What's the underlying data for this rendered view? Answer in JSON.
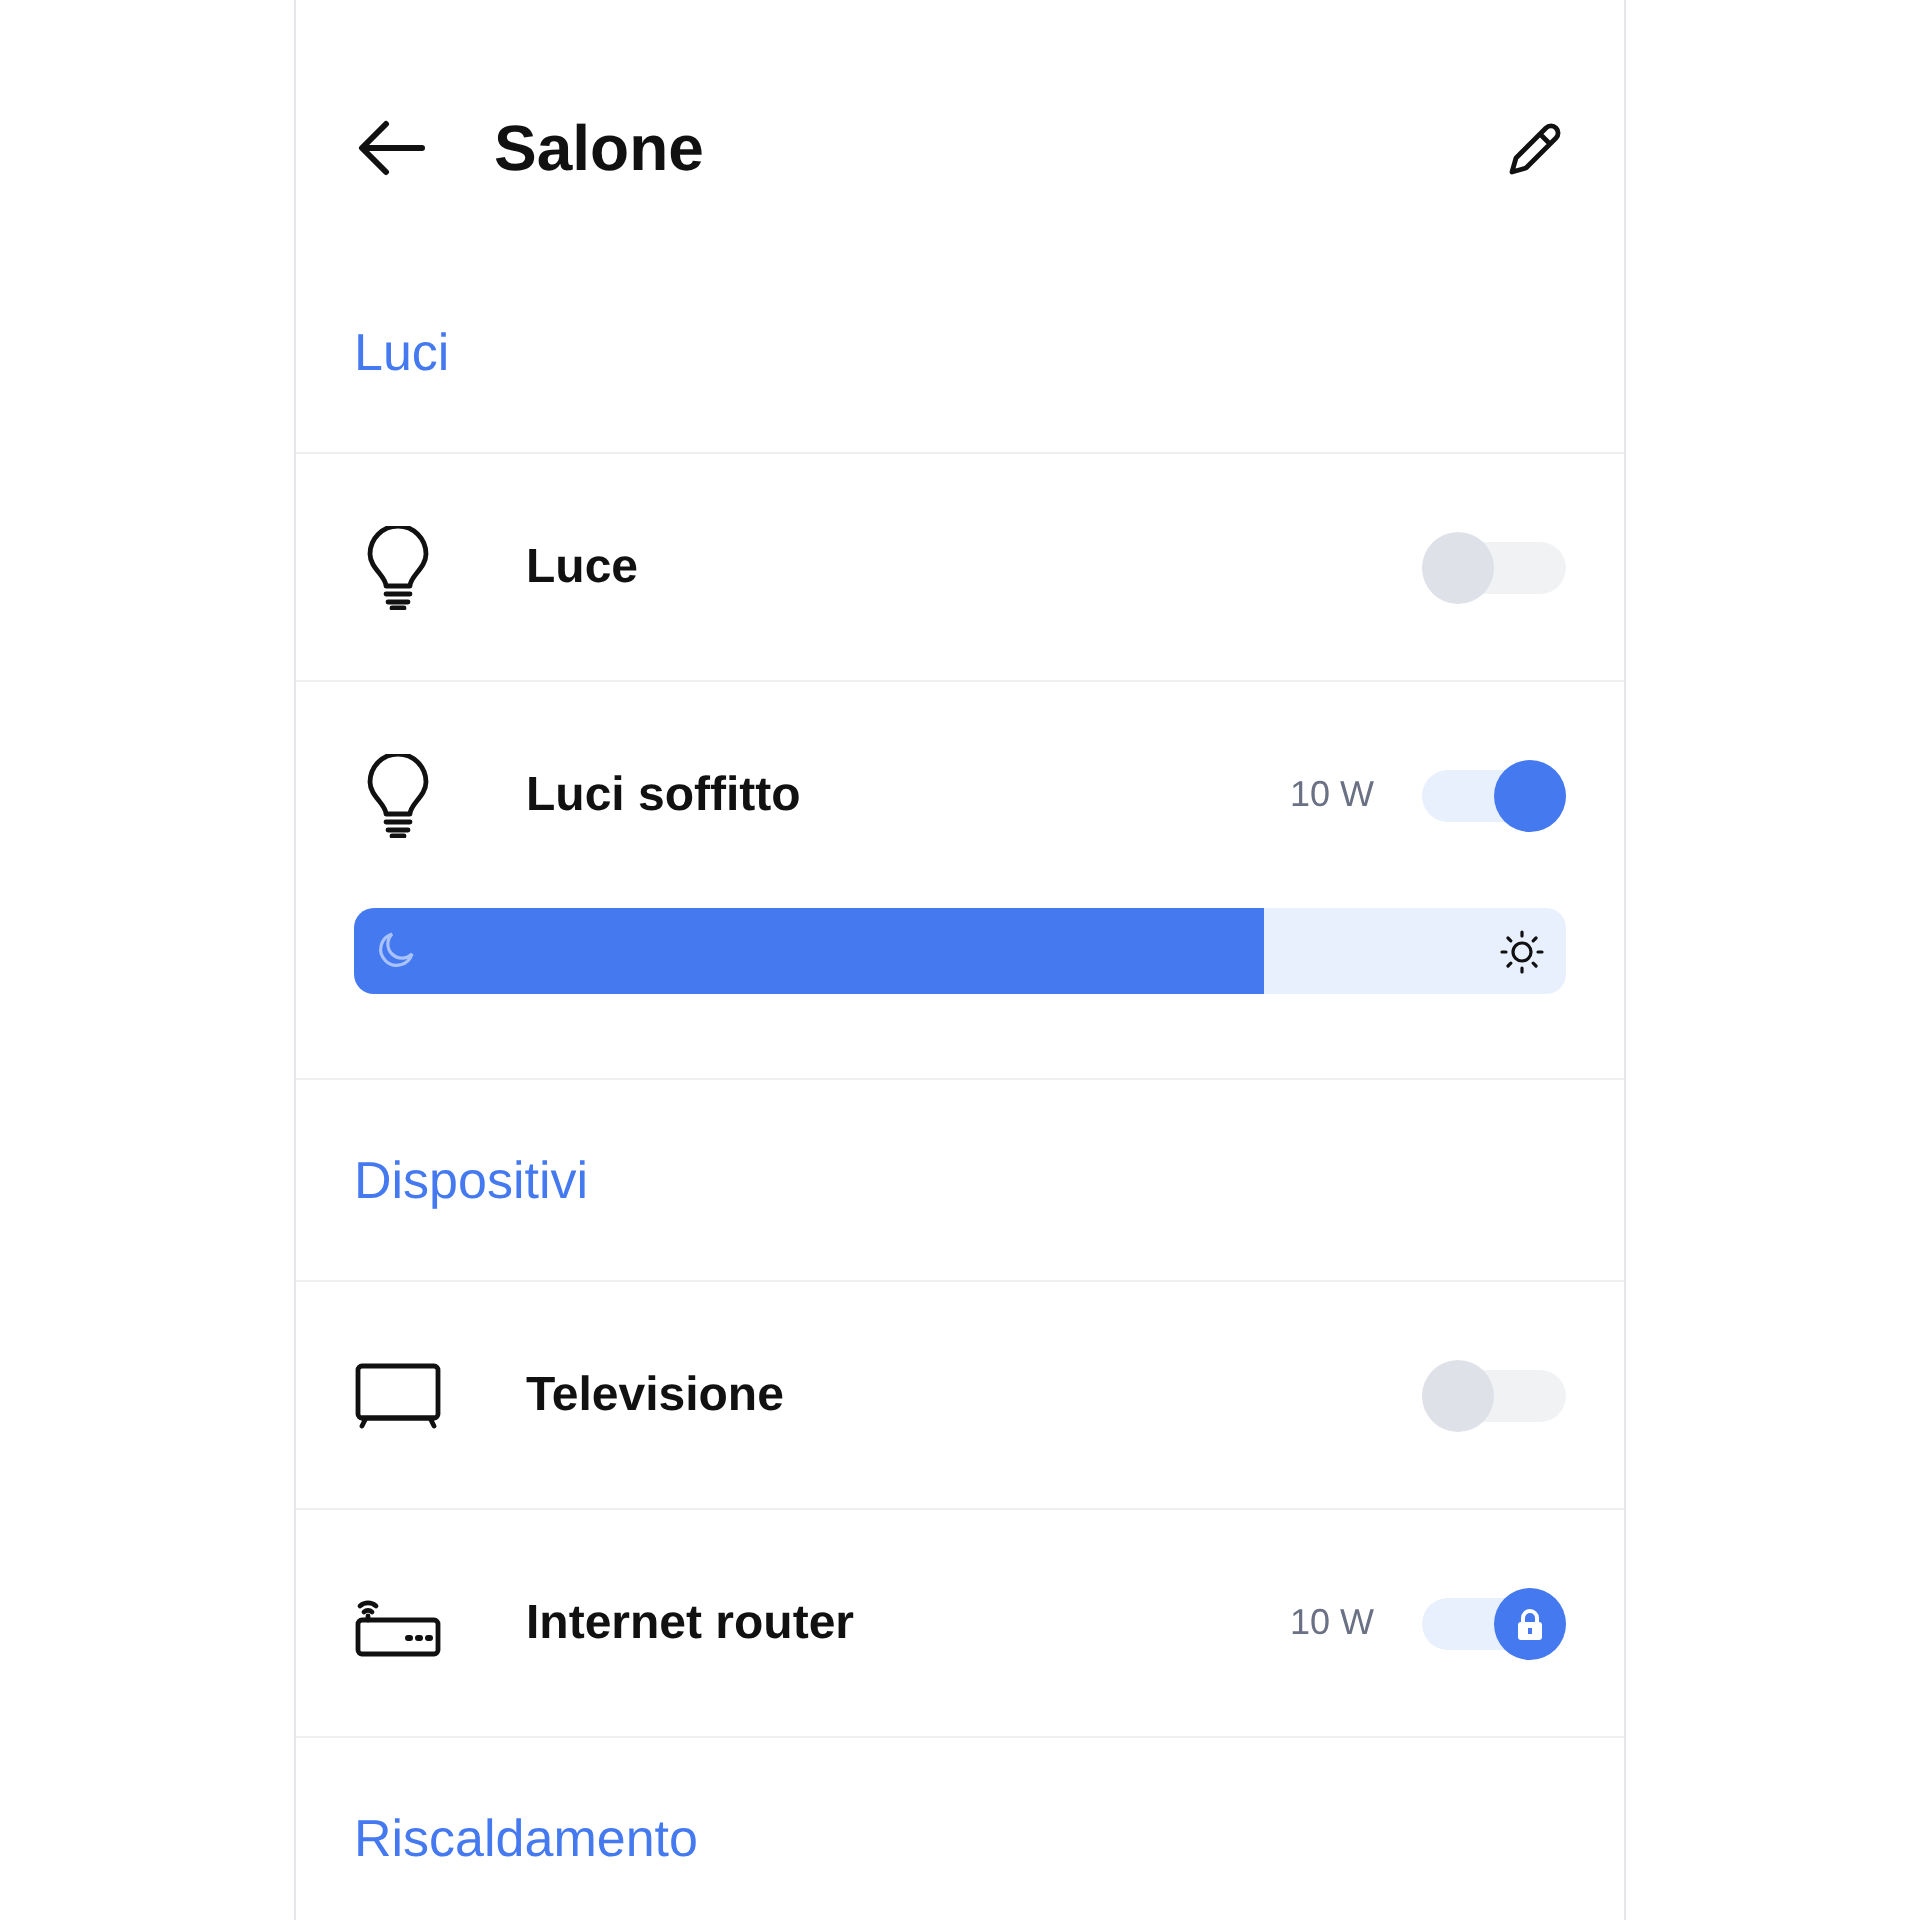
{
  "header": {
    "title": "Salone"
  },
  "sections": [
    {
      "title": "Luci",
      "items": [
        {
          "kind": "light",
          "name": "Luce",
          "on": false
        },
        {
          "kind": "light",
          "name": "Luci soffitto",
          "on": true,
          "reading": "10 W",
          "dimmer": {
            "level": 0.75
          }
        }
      ]
    },
    {
      "title": "Dispositivi",
      "items": [
        {
          "kind": "tv",
          "name": "Televisione",
          "on": false
        },
        {
          "kind": "router",
          "name": "Internet router",
          "on": true,
          "locked": true,
          "reading": "10 W"
        }
      ]
    },
    {
      "title": "Riscaldamento"
    }
  ]
}
